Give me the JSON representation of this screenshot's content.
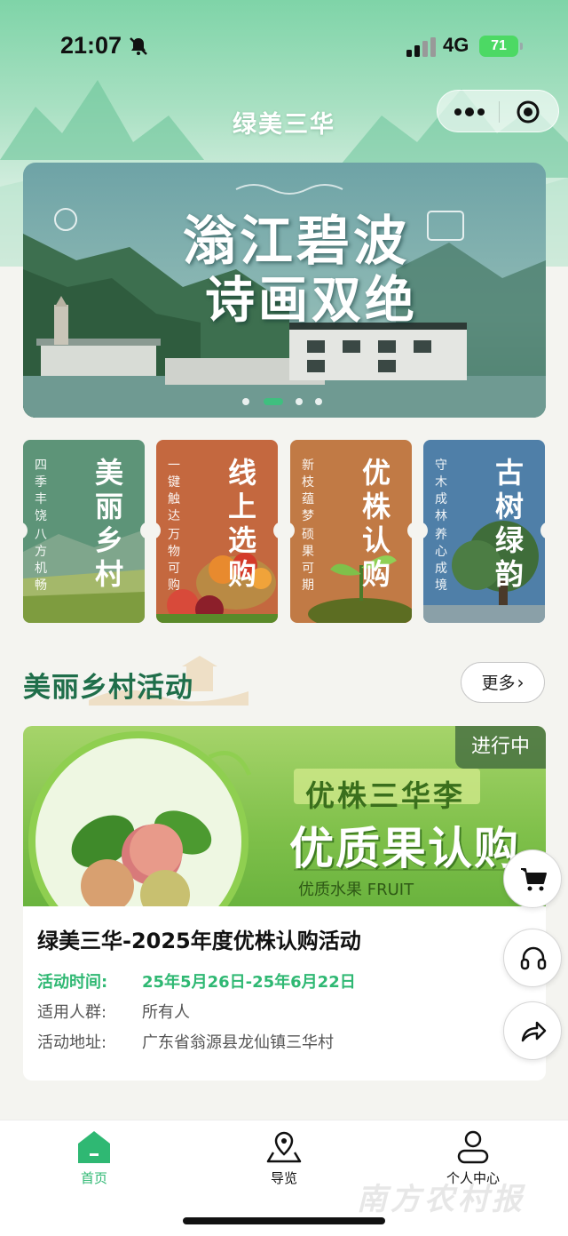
{
  "status_bar": {
    "time": "21:07",
    "network": "4G",
    "battery": "71"
  },
  "nav": {
    "title": "绿美三华"
  },
  "banner": {
    "title_line1": "滃江碧波",
    "title_line2": "诗画双绝",
    "slides_count": 4,
    "active_index": 1
  },
  "categories": [
    {
      "title": "美丽乡村",
      "sub1": "四季丰饶",
      "sub2": "八方机畅",
      "color": "#5d9478"
    },
    {
      "title": "线上选购",
      "sub1": "一键触达",
      "sub2": "万物可购",
      "color": "#c4683f"
    },
    {
      "title": "优株认购",
      "sub1": "新枝蕴梦",
      "sub2": "硕果可期",
      "color": "#c17a45"
    },
    {
      "title": "古树绿韵",
      "sub1": "守木成林",
      "sub2": "养心成境",
      "color": "#4f7fa8"
    }
  ],
  "section": {
    "title": "美丽乡村活动",
    "more_label": "更多",
    "more_icon": "chevron-right-icon"
  },
  "activity": {
    "status": "进行中",
    "promo_line1": "优株三华李",
    "promo_line2": "优质果认购",
    "promo_line3": "优质水果 FRUIT",
    "title": "绿美三华-2025年度优株认购活动",
    "time_label": "活动时间:",
    "time_value": "25年5月26日-25年6月22日",
    "audience_label": "适用人群:",
    "audience_value": "所有人",
    "address_label": "活动地址:",
    "address_value": "广东省翁源县龙仙镇三华村"
  },
  "floating": [
    "cart-icon",
    "headset-icon",
    "share-icon"
  ],
  "tabs": [
    {
      "label": "首页",
      "icon": "home-icon",
      "active": true
    },
    {
      "label": "导览",
      "icon": "map-pin-icon",
      "active": false
    },
    {
      "label": "个人中心",
      "icon": "user-icon",
      "active": false
    }
  ],
  "colors": {
    "accent": "#2fb873",
    "title_green": "#1f6e4a"
  },
  "watermark": "南方农村报"
}
